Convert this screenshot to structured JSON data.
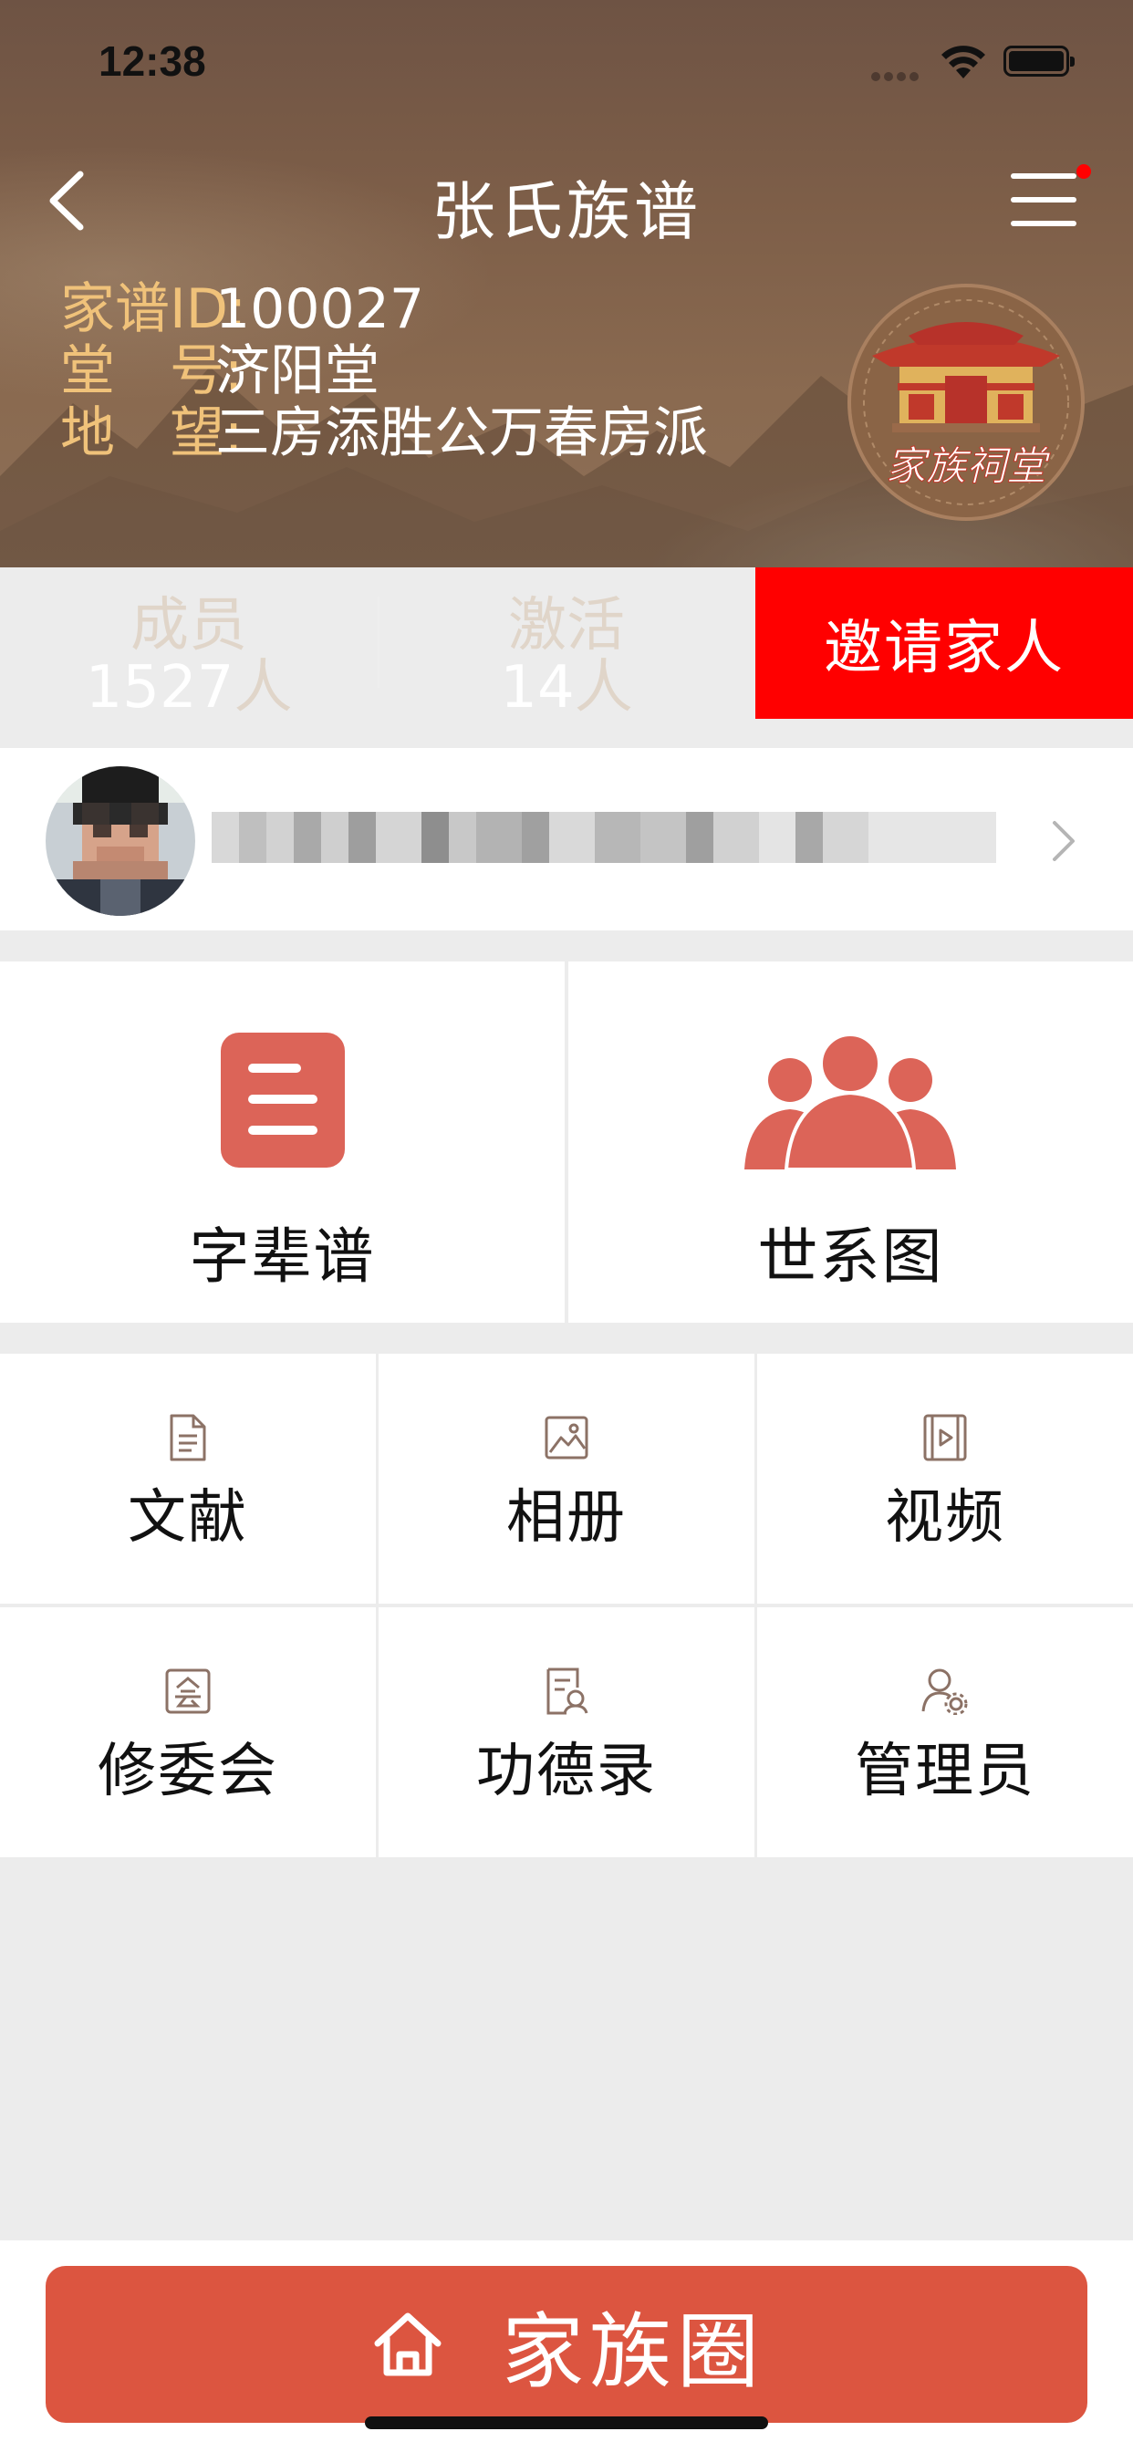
{
  "status_bar": {
    "time": "12:38"
  },
  "nav": {
    "title": "张氏族谱"
  },
  "info": {
    "id_label": "家谱ID:",
    "id_value": "100027",
    "hall_label": "堂　号:",
    "hall_value": "济阳堂",
    "origin_label": "地　望:",
    "origin_value": "三房添胜公万春房派"
  },
  "temple_logo": {
    "text": "家族祠堂"
  },
  "stats": {
    "members_label": "成员",
    "members_value": "1527",
    "members_unit": "人",
    "active_label": "激活",
    "active_value": "14",
    "active_unit": "人",
    "invite_label": "邀请家人"
  },
  "big_tiles": [
    {
      "label": "字辈谱",
      "icon": "list-icon",
      "color": "#dc6458"
    },
    {
      "label": "世系图",
      "icon": "people-group-icon",
      "color": "#dc6458"
    }
  ],
  "grid": [
    {
      "label": "文献",
      "icon": "document-icon"
    },
    {
      "label": "相册",
      "icon": "photo-icon"
    },
    {
      "label": "视频",
      "icon": "video-icon"
    },
    {
      "label": "修委会",
      "icon": "committee-icon"
    },
    {
      "label": "功德录",
      "icon": "merit-record-icon"
    },
    {
      "label": "管理员",
      "icon": "admin-settings-icon"
    }
  ],
  "bottom": {
    "circle_label": "家族圈"
  },
  "colors": {
    "accent_red": "#ff0000",
    "tile_icon": "#dc6458",
    "bottom_button": "#dc5540",
    "label_gold": "#f0c27a"
  }
}
